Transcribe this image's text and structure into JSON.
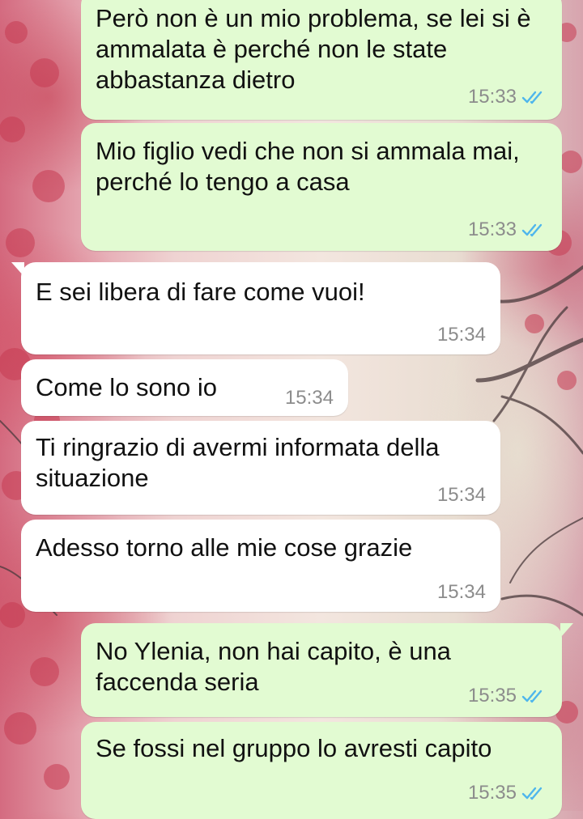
{
  "conversation": {
    "messages": [
      {
        "direction": "outgoing",
        "text": "Però non è un mio problema, se lei si è ammalata è perché non le state abbastanza dietro",
        "time": "15:33",
        "status": "read"
      },
      {
        "direction": "outgoing",
        "text": "Mio figlio vedi che non si ammala mai, perché lo tengo a casa",
        "time": "15:33",
        "status": "read"
      },
      {
        "direction": "incoming",
        "text": "E sei libera di fare come vuoi!",
        "time": "15:34"
      },
      {
        "direction": "incoming",
        "text": "Come lo sono io",
        "time": "15:34"
      },
      {
        "direction": "incoming",
        "text": "Ti ringrazio di avermi informata della situazione",
        "time": "15:34"
      },
      {
        "direction": "incoming",
        "text": "Adesso torno alle mie cose grazie",
        "time": "15:34"
      },
      {
        "direction": "outgoing",
        "text": "No Ylenia, non hai capito, è una faccenda seria",
        "time": "15:35",
        "status": "read"
      },
      {
        "direction": "outgoing",
        "text": "Se fossi nel gruppo lo avresti capito",
        "time": "15:35",
        "status": "read"
      }
    ]
  },
  "colors": {
    "outgoing_bubble": "#e2fbd2",
    "incoming_bubble": "#ffffff",
    "read_ticks": "#4fb6ec",
    "timestamp": "#8c8c8c"
  },
  "icons": {
    "read_status": "double-check-icon"
  }
}
